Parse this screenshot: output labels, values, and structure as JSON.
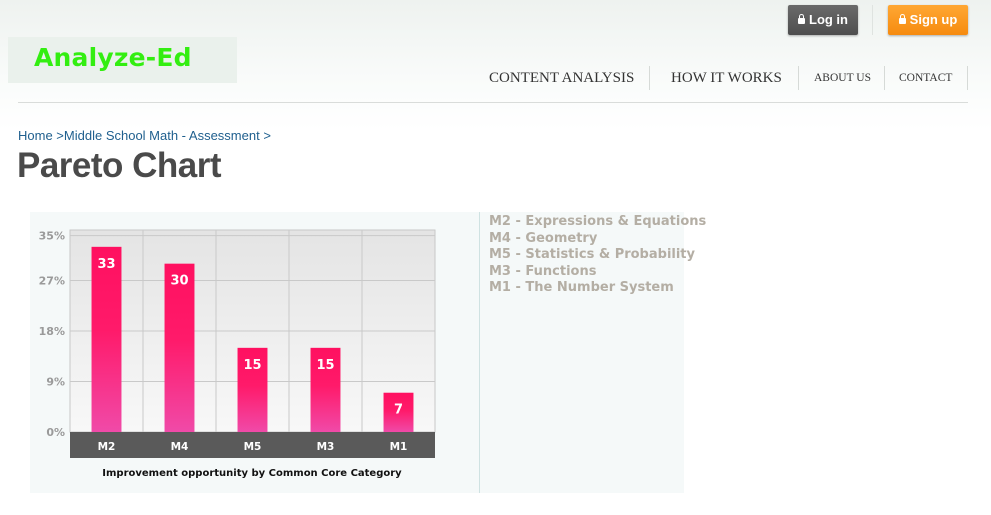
{
  "header": {
    "logo": "Analyze-Ed",
    "login_label": "Log in",
    "signup_label": "Sign up",
    "nav": [
      {
        "label": "CONTENT ANALYSIS"
      },
      {
        "label": "HOW IT WORKS"
      },
      {
        "label": "ABOUT US"
      },
      {
        "label": "CONTACT"
      }
    ]
  },
  "breadcrumb": {
    "home": "Home",
    "sep1": " >",
    "section": "Middle School Math - Assessment",
    "sep2": " >"
  },
  "page_title": "Pareto Chart",
  "legend": [
    "M2 - Expressions & Equations",
    "M4 - Geometry",
    "M5 - Statistics & Probability",
    "M3 - Functions",
    "M1 - The Number System"
  ],
  "colors": {
    "bar_top": "#ff1060",
    "bar_bottom": "#f04aa8",
    "axis_band": "#5a5a5a",
    "login": "#5a5a5a",
    "signup": "#f7931e",
    "logo": "#33ee11",
    "link": "#1f5f8e"
  },
  "chart_data": {
    "type": "bar",
    "categories": [
      "M2",
      "M4",
      "M5",
      "M3",
      "M1"
    ],
    "values": [
      33,
      30,
      15,
      15,
      7
    ],
    "y_ticks": [
      {
        "value": 0,
        "label": "0%"
      },
      {
        "value": 9,
        "label": "9%"
      },
      {
        "value": 18,
        "label": "18%"
      },
      {
        "value": 27,
        "label": "27%"
      },
      {
        "value": 35,
        "label": "35%"
      }
    ],
    "ylim": [
      0,
      36
    ],
    "xlabel": "Improvement opportunity by Common Core Category",
    "ylabel": "",
    "title": "",
    "grid": true
  }
}
